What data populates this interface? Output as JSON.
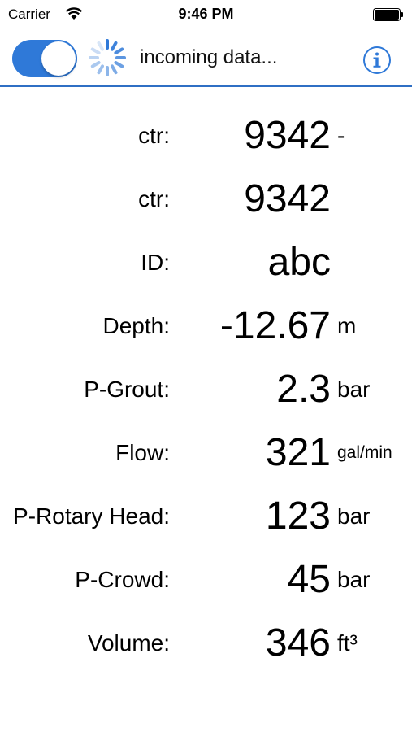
{
  "status_bar": {
    "carrier": "Carrier",
    "time": "9:46 PM"
  },
  "toolbar": {
    "toggle_on": true,
    "status_text": "incoming data...",
    "accent_color": "#2f79d8"
  },
  "readings": [
    {
      "label": "ctr:",
      "value": "9342",
      "unit": "-"
    },
    {
      "label": "ctr:",
      "value": "9342",
      "unit": ""
    },
    {
      "label": "ID:",
      "value": "abc",
      "unit": ""
    },
    {
      "label": "Depth:",
      "value": "-12.67",
      "unit": "m"
    },
    {
      "label": "P-Grout:",
      "value": "2.3",
      "unit": "bar"
    },
    {
      "label": "Flow:",
      "value": "321",
      "unit": "gal/min"
    },
    {
      "label": "P-Rotary Head:",
      "value": "123",
      "unit": "bar"
    },
    {
      "label": "P-Crowd:",
      "value": "45",
      "unit": "bar"
    },
    {
      "label": "Volume:",
      "value": "346",
      "unit": "ft³"
    }
  ]
}
